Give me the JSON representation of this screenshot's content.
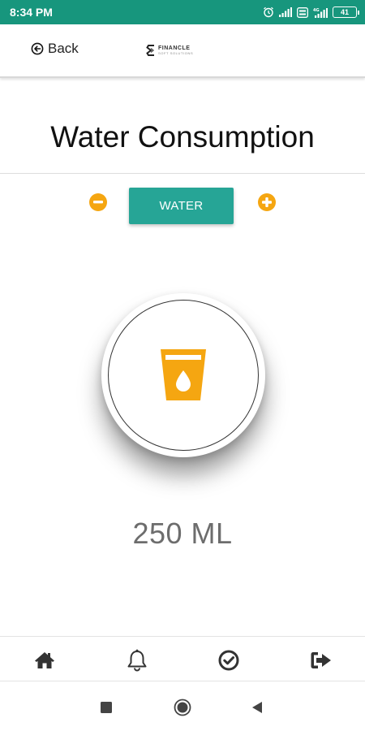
{
  "status_bar": {
    "time": "8:34 PM",
    "battery": "41",
    "background_color": "#17967d",
    "icons": [
      "alarm-icon",
      "signal-icon",
      "volte-icon",
      "signal-4g-icon",
      "battery-icon"
    ]
  },
  "header": {
    "back_label": "Back",
    "back_icon": "arrow-left-circle-icon",
    "logo_name": "FINANCLE",
    "logo_sub": "SOFT SOLUTIONS"
  },
  "page": {
    "title": "Water Consumption",
    "water_button_label": "WATER",
    "minus_icon": "minus-circle-icon",
    "plus_icon": "plus-circle-icon",
    "glass_icon": "water-glass-icon",
    "amount": "250 ML",
    "accent_color": "#f5a611",
    "button_color": "#26a596"
  },
  "bottom_nav": {
    "items": [
      {
        "name": "home",
        "icon": "home-icon"
      },
      {
        "name": "notifications",
        "icon": "bell-icon"
      },
      {
        "name": "check",
        "icon": "check-circle-icon"
      },
      {
        "name": "logout",
        "icon": "sign-out-icon"
      }
    ]
  },
  "system_nav": {
    "icons": [
      "recent-apps-icon",
      "home-circle-icon",
      "back-triangle-icon"
    ]
  }
}
